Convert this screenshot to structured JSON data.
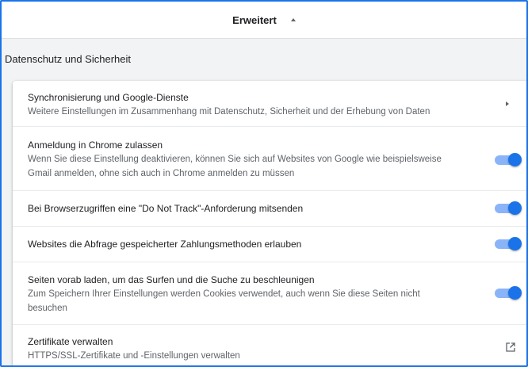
{
  "header": {
    "expand_label": "Erweitert"
  },
  "section": {
    "title": "Datenschutz und Sicherheit"
  },
  "rows": [
    {
      "title": "Synchronisierung und Google-Dienste",
      "subtitle": "Weitere Einstellungen im Zusammenhang mit Datenschutz, Sicherheit und der Erhebung von Daten",
      "control": "chevron-right-icon"
    },
    {
      "title": "Anmeldung in Chrome zulassen",
      "subtitle_line1": "Wenn Sie diese Einstellung deaktivieren, können Sie sich auf Websites von Google wie beispielsweise",
      "subtitle_line2": "Gmail anmelden, ohne sich auch in Chrome anmelden zu müssen",
      "control": "toggle",
      "enabled": true
    },
    {
      "title": "Bei Browserzugriffen eine \"Do Not Track\"-Anforderung mitsenden",
      "control": "toggle",
      "enabled": true
    },
    {
      "title": "Websites die Abfrage gespeicherter Zahlungsmethoden erlauben",
      "control": "toggle",
      "enabled": true
    },
    {
      "title": "Seiten vorab laden, um das Surfen und die Suche zu beschleunigen",
      "subtitle_line1": "Zum Speichern Ihrer Einstellungen werden Cookies verwendet, auch wenn Sie diese Seiten nicht",
      "subtitle_line2": "besuchen",
      "control": "toggle",
      "enabled": true
    },
    {
      "title": "Zertifikate verwalten",
      "subtitle": "HTTPS/SSL-Zertifikate und -Einstellungen verwalten",
      "control": "external-link-icon"
    }
  ],
  "colors": {
    "accent": "#1a73e8",
    "toggle_track": "#8ab4f8",
    "background": "#f1f3f4",
    "secondary_text": "#5f6368"
  }
}
